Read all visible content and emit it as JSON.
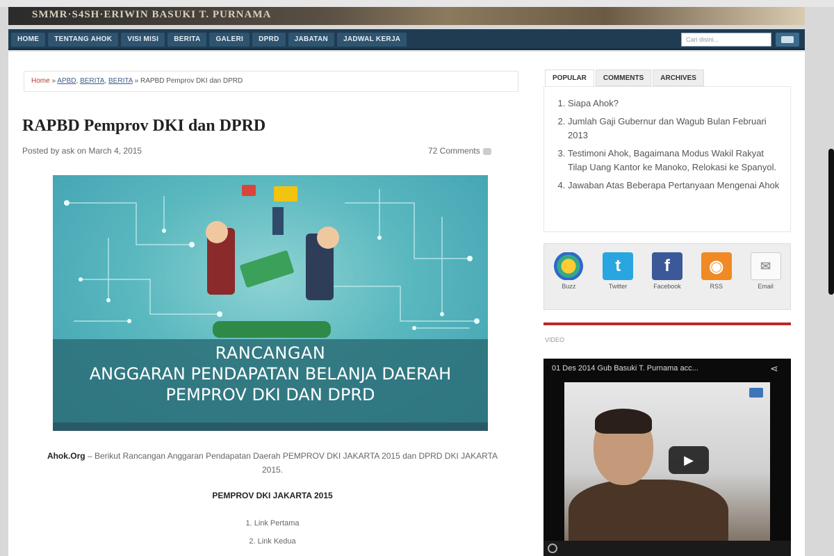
{
  "banner": {
    "text": "SMMR·S4SH·ERIWIN BASUKI T. PURNAMA"
  },
  "nav": {
    "items": [
      "Home",
      "Tentang Ahok",
      "Visi Misi",
      "Berita",
      "Galeri",
      "DPRD",
      "Jabatan",
      "Jadwal Kerja"
    ],
    "search_placeholder": "Cari disini..."
  },
  "breadcrumb": {
    "home": "Home",
    "sep1": "»",
    "cat1": "APBD",
    "cat2": "BERITA",
    "cat3": "BERITA",
    "sep2": "»",
    "current": "RAPBD Pemprov DKI dan DPRD"
  },
  "post": {
    "title": "RAPBD Pemprov DKI dan DPRD",
    "meta": "Posted by ask on March 4, 2015",
    "comments": "72 Comments",
    "image_caption_1": "RANCANGAN",
    "image_caption_2": "ANGGARAN PENDAPATAN BELANJA DAERAH",
    "image_caption_3": "PEMPROV DKI DAN DPRD",
    "lead_strong": "Ahok.Org",
    "lead_text": " – Berikut Rancangan Anggaran Pendapatan Daerah PEMPROV DKI JAKARTA 2015 dan DPRD DKI JAKARTA 2015.",
    "section_heading": "PEMPROV DKI JAKARTA 2015",
    "links": [
      "1. Link Pertama",
      "2. Link Kedua"
    ]
  },
  "sidebar": {
    "tabs": [
      "Popular",
      "Comments",
      "Archives"
    ],
    "popular": [
      "Siapa Ahok?",
      "Jumlah Gaji Gubernur dan Wagub Bulan Februari 2013",
      "Testimoni Ahok, Bagaimana Modus Wakil Rakyat Tilap Uang Kantor ke Manoko, Relokasi ke Spanyol.",
      "Jawaban Atas Beberapa Pertanyaan Mengenai Ahok"
    ],
    "social": [
      {
        "label": "Buzz",
        "icon": "buzz-icon"
      },
      {
        "label": "Twitter",
        "icon": "twitter-icon"
      },
      {
        "label": "Facebook",
        "icon": "facebook-icon"
      },
      {
        "label": "RSS",
        "icon": "rss-icon"
      },
      {
        "label": "Email",
        "icon": "email-icon"
      }
    ],
    "video_heading": "Video",
    "video_title": "01 Des 2014 Gub Basuki T. Purnama acc..."
  },
  "colors": {
    "nav_bg": "#1f3c53",
    "accent_red": "#c0262a",
    "link": "#3a5f86"
  }
}
